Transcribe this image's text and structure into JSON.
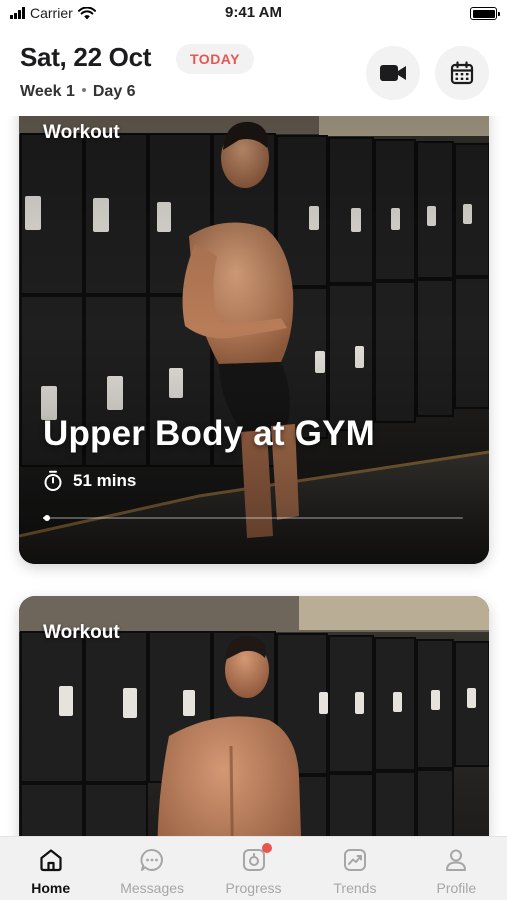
{
  "status_bar": {
    "carrier": "Carrier",
    "time": "9:41 AM"
  },
  "header": {
    "date": "Sat, 22 Oct",
    "today_badge": "TODAY",
    "week": "Week 1",
    "day": "Day 6",
    "video_icon": "video-camera-icon",
    "calendar_icon": "calendar-icon"
  },
  "feed": {
    "cards": [
      {
        "label": "Workout",
        "title": "Upper Body at GYM",
        "duration": "51 mins",
        "progress": 0.01
      },
      {
        "label": "Workout"
      }
    ]
  },
  "tabbar": {
    "active": "Home",
    "tabs": [
      {
        "label": "Home",
        "icon": "home-icon"
      },
      {
        "label": "Messages",
        "icon": "chat-icon"
      },
      {
        "label": "Progress",
        "icon": "progress-icon",
        "badge": true
      },
      {
        "label": "Trends",
        "icon": "trend-chart-icon"
      },
      {
        "label": "Profile",
        "icon": "profile-icon"
      }
    ]
  },
  "colors": {
    "accent": "#e8564f",
    "tabbar_bg": "#f1f1f1",
    "inactive": "#a6a6a6"
  }
}
